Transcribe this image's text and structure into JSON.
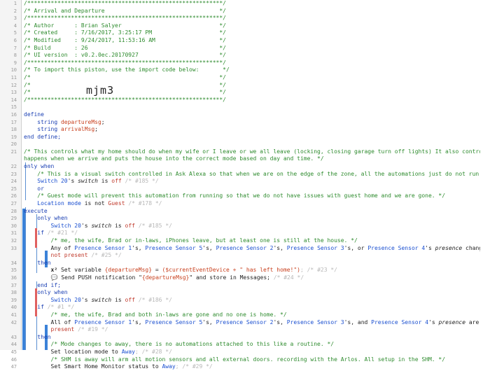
{
  "watermark": "mjm3",
  "lines": [
    {
      "n": "1",
      "t": [
        {
          "c": "/**********************************************************/",
          "k": "c"
        }
      ]
    },
    {
      "n": "2",
      "t": [
        {
          "c": "/* Arrival and Departure                                  */",
          "k": "c"
        }
      ]
    },
    {
      "n": "3",
      "t": [
        {
          "c": "/**********************************************************/",
          "k": "c"
        }
      ]
    },
    {
      "n": "4",
      "t": [
        {
          "c": "/* Author      : Brian Salyer                             */",
          "k": "c"
        }
      ]
    },
    {
      "n": "5",
      "t": [
        {
          "c": "/* Created     : 7/16/2017, 3:25:17 PM                    */",
          "k": "c"
        }
      ]
    },
    {
      "n": "6",
      "t": [
        {
          "c": "/* Modified    : 9/24/2017, 11:53:16 AM                   */",
          "k": "c"
        }
      ]
    },
    {
      "n": "7",
      "t": [
        {
          "c": "/* Build       : 26                                       */",
          "k": "c"
        }
      ]
    },
    {
      "n": "8",
      "t": [
        {
          "c": "/* UI version  : v0.2.0ec.20170927                        */",
          "k": "c"
        }
      ]
    },
    {
      "n": "9",
      "t": [
        {
          "c": "/**********************************************************/",
          "k": "c"
        }
      ]
    },
    {
      "n": "10",
      "t": [
        {
          "c": "/* To import this piston, use the import code below:       */",
          "k": "c"
        }
      ]
    },
    {
      "n": "11",
      "t": [
        {
          "c": "/*                                                        */",
          "k": "c"
        }
      ]
    },
    {
      "n": "12",
      "t": [
        {
          "c": "/*                                                        */",
          "k": "c"
        }
      ]
    },
    {
      "n": "13",
      "t": [
        {
          "c": "/*                                                        */",
          "k": "c"
        }
      ]
    },
    {
      "n": "14",
      "t": [
        {
          "c": "/**********************************************************/",
          "k": "c"
        }
      ]
    },
    {
      "n": "15",
      "t": []
    },
    {
      "n": "16",
      "t": [
        {
          "c": "define",
          "k": "k"
        }
      ]
    },
    {
      "n": "17",
      "t": [
        {
          "c": "    string ",
          "k": "k"
        },
        {
          "c": "departureMsg",
          "k": "v"
        },
        {
          "c": ";",
          "k": ""
        }
      ]
    },
    {
      "n": "18",
      "t": [
        {
          "c": "    string ",
          "k": "k"
        },
        {
          "c": "arrivalMsg",
          "k": "v"
        },
        {
          "c": ";",
          "k": ""
        }
      ]
    },
    {
      "n": "19",
      "t": [
        {
          "c": "end define;",
          "k": "k"
        }
      ]
    },
    {
      "n": "20",
      "t": []
    },
    {
      "n": "21",
      "t": [
        {
          "c": "/* This controls what my home should do when my wife or I leave or we all leave (locking, closing garage turn off lights) It also controls what",
          "k": "c"
        }
      ]
    },
    {
      "n": "",
      "t": [
        {
          "c": "happens when we arrive and puts the house into the correct mode based on day and time. */",
          "k": "c"
        }
      ]
    },
    {
      "n": "22",
      "t": [
        {
          "c": "only when",
          "k": "k"
        }
      ]
    },
    {
      "n": "23",
      "t": [
        {
          "c": "    /* This is a visual switch controlled in Ask Alexa so that when we are on the edge of the zone, all the automations just do not run. */",
          "k": "c"
        }
      ]
    },
    {
      "n": "24",
      "t": [
        {
          "c": "    ",
          "k": ""
        },
        {
          "c": "Switch 20",
          "k": "d"
        },
        {
          "c": "'s ",
          "k": ""
        },
        {
          "c": "switch",
          "k": "i"
        },
        {
          "c": " is ",
          "k": ""
        },
        {
          "c": "off",
          "k": "s"
        },
        {
          "c": " /* #185 */",
          "k": "h"
        }
      ]
    },
    {
      "n": "25",
      "t": [
        {
          "c": "    or",
          "k": "k"
        }
      ]
    },
    {
      "n": "26",
      "t": [
        {
          "c": "    /* Guest mode will prevent this automation from running so that we do not have issues with guest home and we are gone. */",
          "k": "c"
        }
      ]
    },
    {
      "n": "27",
      "t": [
        {
          "c": "    ",
          "k": ""
        },
        {
          "c": "Location mode",
          "k": "d"
        },
        {
          "c": " is not ",
          "k": ""
        },
        {
          "c": "Guest",
          "k": "s"
        },
        {
          "c": " /* #178 */",
          "k": "h"
        }
      ]
    },
    {
      "n": "28",
      "t": [
        {
          "c": "execute",
          "k": "k"
        }
      ]
    },
    {
      "n": "29",
      "t": [
        {
          "c": "    only when",
          "k": "k"
        }
      ]
    },
    {
      "n": "30",
      "t": [
        {
          "c": "        ",
          "k": ""
        },
        {
          "c": "Switch 20",
          "k": "d"
        },
        {
          "c": "'s ",
          "k": ""
        },
        {
          "c": "switch",
          "k": "i"
        },
        {
          "c": " is ",
          "k": ""
        },
        {
          "c": "off",
          "k": "s"
        },
        {
          "c": " /* #185 */",
          "k": "h"
        }
      ]
    },
    {
      "n": "31",
      "t": [
        {
          "c": "    if",
          "k": "k"
        },
        {
          "c": " /* #21 */",
          "k": "h"
        }
      ]
    },
    {
      "n": "32",
      "t": [
        {
          "c": "        /* me, the wife, Brad or in-laws, iPhones leave, but at least one is still at the house. */",
          "k": "c"
        }
      ]
    },
    {
      "n": "33",
      "t": [
        {
          "c": "        Any of ",
          "k": ""
        },
        {
          "c": "Presence Sensor 1",
          "k": "d"
        },
        {
          "c": "'s, ",
          "k": ""
        },
        {
          "c": "Presence Sensor 5",
          "k": "d"
        },
        {
          "c": "'s, ",
          "k": ""
        },
        {
          "c": "Presence Sensor 2",
          "k": "d"
        },
        {
          "c": "'s, ",
          "k": ""
        },
        {
          "c": "Presence Sensor 3",
          "k": "d"
        },
        {
          "c": "'s, or ",
          "k": ""
        },
        {
          "c": "Presence Sensor 4",
          "k": "d"
        },
        {
          "c": "'s ",
          "k": ""
        },
        {
          "c": "presence",
          "k": "i"
        },
        {
          "c": " changes to",
          "k": ""
        }
      ]
    },
    {
      "n": "",
      "t": [
        {
          "c": "        ",
          "k": ""
        },
        {
          "c": "not present",
          "k": "s"
        },
        {
          "c": " /* #25 */",
          "k": "h"
        }
      ]
    },
    {
      "n": "34",
      "t": [
        {
          "c": "    then",
          "k": "k"
        }
      ]
    },
    {
      "n": "35",
      "t": [
        {
          "c": "        ",
          "k": ""
        },
        {
          "c": "x²",
          "k": "b"
        },
        {
          "c": " Set variable ",
          "k": ""
        },
        {
          "c": "{departureMsg}",
          "k": "v"
        },
        {
          "c": " = ",
          "k": ""
        },
        {
          "c": "($currentEventDevice + \" has left home!\")",
          "k": "v"
        },
        {
          "c": "; /* #23 */",
          "k": "h"
        }
      ]
    },
    {
      "n": "36",
      "t": [
        {
          "c": "        ",
          "k": ""
        },
        {
          "c": "💬",
          "k": "icon"
        },
        {
          "c": " Send PUSH notification \"",
          "k": ""
        },
        {
          "c": "{departureMsg}",
          "k": "v"
        },
        {
          "c": "\" and store in Messages; ",
          "k": ""
        },
        {
          "c": "/* #24 */",
          "k": "h"
        }
      ]
    },
    {
      "n": "37",
      "t": [
        {
          "c": "    end if;",
          "k": "k"
        }
      ]
    },
    {
      "n": "38",
      "t": [
        {
          "c": "    only when",
          "k": "k"
        }
      ]
    },
    {
      "n": "39",
      "t": [
        {
          "c": "        ",
          "k": ""
        },
        {
          "c": "Switch 20",
          "k": "d"
        },
        {
          "c": "'s ",
          "k": ""
        },
        {
          "c": "switch",
          "k": "i"
        },
        {
          "c": " is ",
          "k": ""
        },
        {
          "c": "off",
          "k": "s"
        },
        {
          "c": " /* #186 */",
          "k": "h"
        }
      ]
    },
    {
      "n": "40",
      "t": [
        {
          "c": "    if",
          "k": "k"
        },
        {
          "c": " /* #1 */",
          "k": "h"
        }
      ]
    },
    {
      "n": "41",
      "t": [
        {
          "c": "        /* me, the wife, Brad and both in-laws are gone and no one is home. */",
          "k": "c"
        }
      ]
    },
    {
      "n": "42",
      "t": [
        {
          "c": "        All of ",
          "k": ""
        },
        {
          "c": "Presence Sensor 1",
          "k": "d"
        },
        {
          "c": "'s, ",
          "k": ""
        },
        {
          "c": "Presence Sensor 5",
          "k": "d"
        },
        {
          "c": "'s, ",
          "k": ""
        },
        {
          "c": "Presence Sensor 2",
          "k": "d"
        },
        {
          "c": "'s, ",
          "k": ""
        },
        {
          "c": "Presence Sensor 3",
          "k": "d"
        },
        {
          "c": "'s, and ",
          "k": ""
        },
        {
          "c": "Presence Sensor 4",
          "k": "d"
        },
        {
          "c": "'s ",
          "k": ""
        },
        {
          "c": "presence",
          "k": "i"
        },
        {
          "c": " are not",
          "k": ""
        }
      ]
    },
    {
      "n": "",
      "t": [
        {
          "c": "        ",
          "k": ""
        },
        {
          "c": "present",
          "k": "s"
        },
        {
          "c": " /* #19 */",
          "k": "h"
        }
      ]
    },
    {
      "n": "43",
      "t": [
        {
          "c": "    then",
          "k": "k"
        }
      ]
    },
    {
      "n": "44",
      "t": [
        {
          "c": "        /* Mode changes to away, there is no automations attached to this like a routine. */",
          "k": "c"
        }
      ]
    },
    {
      "n": "45",
      "t": [
        {
          "c": "        Set location mode to ",
          "k": ""
        },
        {
          "c": "Away",
          "k": "d"
        },
        {
          "c": "; /* #28 */",
          "k": "h"
        }
      ]
    },
    {
      "n": "46",
      "t": [
        {
          "c": "        /* SHM is away will arm all motion sensors and all external doors. recording with the Arlos. All setup in the SHM. */",
          "k": "c"
        }
      ]
    },
    {
      "n": "47",
      "t": [
        {
          "c": "        Set Smart Home Monitor status to ",
          "k": ""
        },
        {
          "c": "Away",
          "k": "d"
        },
        {
          "c": "; /* #29 */",
          "k": "h"
        }
      ]
    }
  ]
}
